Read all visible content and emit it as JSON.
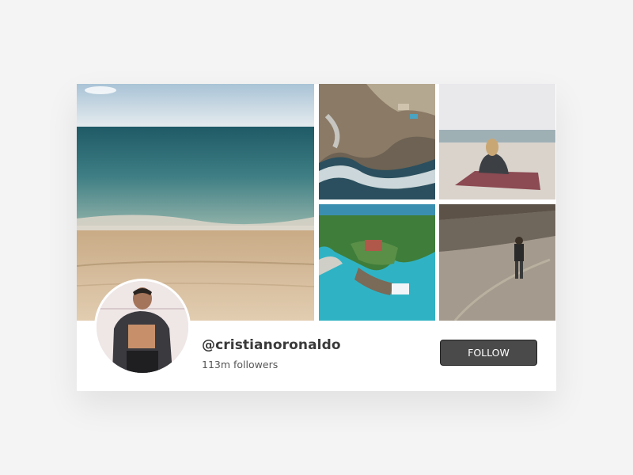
{
  "profile": {
    "username": "@cristianoronaldo",
    "followers": "113m followers",
    "follow_label": "FOLLOW"
  },
  "colors": {
    "background": "#f4f4f4",
    "card": "#ffffff",
    "button": "#4a4a4a",
    "username_text": "#3a3a3a"
  }
}
